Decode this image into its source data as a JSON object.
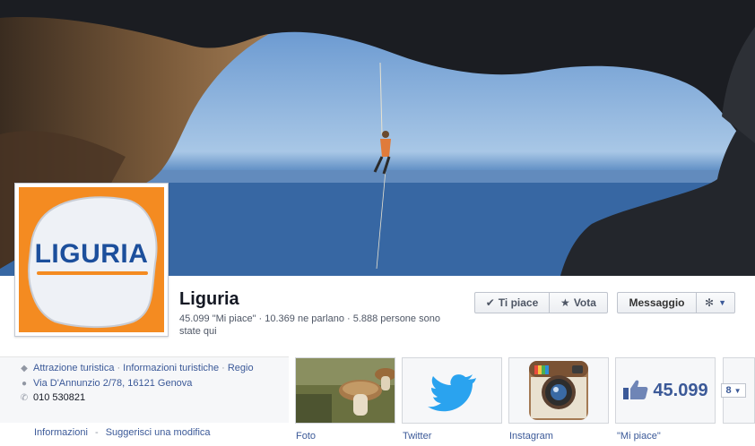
{
  "page": {
    "name": "Liguria",
    "stats": "45.099 \"Mi piace\" · 10.369 ne parlano · 5.888 persone sono state qui"
  },
  "profile": {
    "logo_text": "LIGURIA"
  },
  "actions": {
    "like_label": "Ti piace",
    "like_icon": "check-icon",
    "vote_label": "Vota",
    "vote_icon": "star-icon",
    "message_label": "Messaggio",
    "settings_icon": "gear-icon"
  },
  "info": {
    "categories": [
      "Attrazione turistica",
      "Informazioni turistiche",
      "Regio"
    ],
    "address": "Via D'Annunzio 2/78, 16121 Genova",
    "phone": "010 530821",
    "links": [
      "Informazioni",
      "Suggerisci una modifica"
    ]
  },
  "apps": {
    "photos_label": "Foto",
    "twitter_label": "Twitter",
    "instagram_label": "Instagram",
    "likes_count": "45.099",
    "likes_label": "\"Mi piace\"",
    "more_count": "8"
  },
  "colors": {
    "link": "#3b5998",
    "orange": "#f48b21",
    "logo_blue": "#1c4f9c",
    "twitter_blue": "#2aa3ef"
  }
}
